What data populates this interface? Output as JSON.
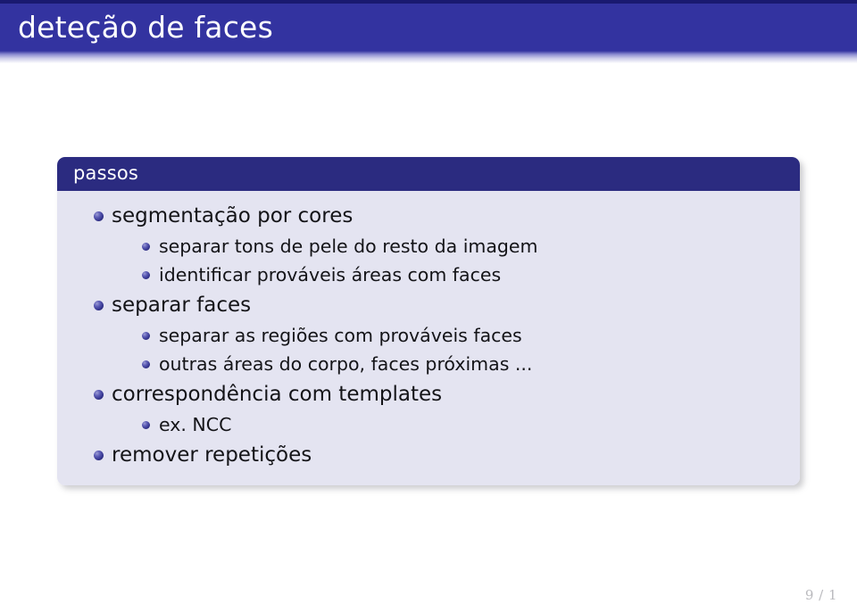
{
  "slide": {
    "title": "deteção de faces",
    "page_number": "9 / 1",
    "colors": {
      "title_bar": "#3333a0",
      "title_bar_stripe": "#191970",
      "block_header": "#2b2b80",
      "block_body": "#e4e4f1",
      "bullet": "#33338c",
      "body_text": "#141418",
      "page_number": "#b9b9bd"
    }
  },
  "block": {
    "title": "passos",
    "items": [
      {
        "label": "segmentação por cores",
        "children": [
          {
            "label": "separar tons de pele do resto da imagem"
          },
          {
            "label": "identificar prováveis áreas com faces"
          }
        ]
      },
      {
        "label": "separar faces",
        "children": [
          {
            "label": "separar as regiões com prováveis faces"
          },
          {
            "label": "outras áreas do corpo, faces próximas ..."
          }
        ]
      },
      {
        "label": "correspondência com templates",
        "children": [
          {
            "label": "ex. NCC"
          }
        ]
      },
      {
        "label": "remover repetições",
        "children": []
      }
    ]
  }
}
